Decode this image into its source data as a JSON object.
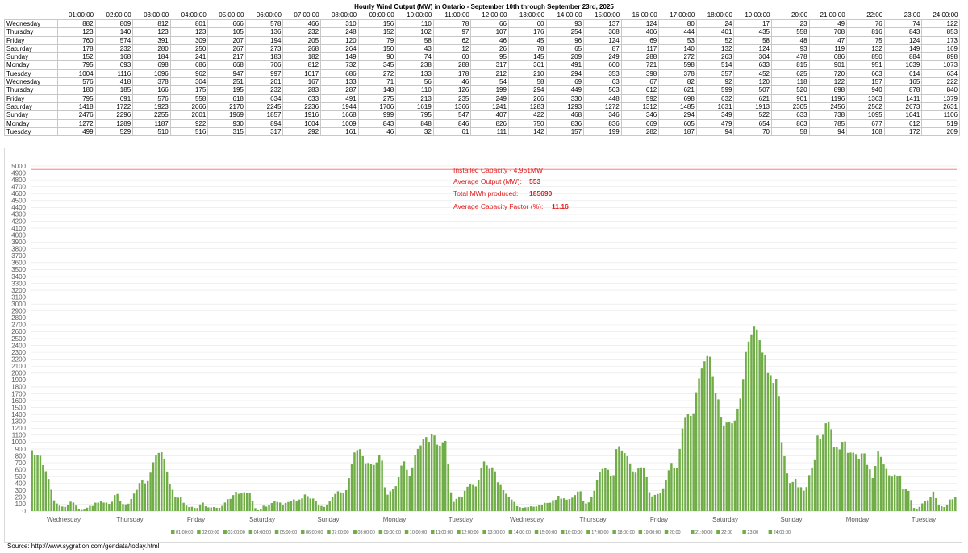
{
  "title": "Hourly Wind Output (MW) in Ontario - September 10th through September 23rd, 2025",
  "source": "Source: http://www.sygration.com/gendata/today.html",
  "hours": [
    "01:00:00",
    "02:00:00",
    "03:00:00",
    "04:00:00",
    "05:00:00",
    "06:00:00",
    "07:00:00",
    "08:00:00",
    "09:00:00",
    "10:00:00",
    "11:00:00",
    "12:00:00",
    "13:00:00",
    "14:00:00",
    "15:00:00",
    "16:00:00",
    "17:00:00",
    "18:00:00",
    "19:00:00",
    "20:00",
    "21:00:00",
    "22:00",
    "23:00",
    "24:00:00"
  ],
  "annotations": {
    "capacity_label": "Installed Capacity - 4,951MW",
    "avg_output_label": "Average Output (MW):",
    "avg_output_value": "553",
    "total_label": "Total MWh produced:",
    "total_value": "185690",
    "cf_label": "Average Capacity Factor (%):",
    "cf_value": "11.16"
  },
  "chart_data": {
    "type": "bar",
    "title": "Hourly Wind Output (MW) in Ontario - September 10th through September 23rd, 2025",
    "ylim": [
      0,
      5000
    ],
    "ytick_step": 100,
    "grid": true,
    "legend": "bottom",
    "series_color": "#70ad47",
    "capacity_line": 4951,
    "capacity_color": "#ff6b6b",
    "days": [
      {
        "day": "Wednesday",
        "values": [
          882,
          809,
          812,
          801,
          666,
          578,
          466,
          310,
          156,
          110,
          78,
          66,
          60,
          93,
          137,
          124,
          80,
          24,
          17,
          23,
          49,
          76,
          74,
          122
        ]
      },
      {
        "day": "Thursday",
        "values": [
          123,
          140,
          123,
          123,
          105,
          136,
          232,
          248,
          152,
          102,
          97,
          107,
          176,
          254,
          308,
          406,
          444,
          401,
          435,
          558,
          708,
          816,
          843,
          853
        ]
      },
      {
        "day": "Friday",
        "values": [
          760,
          574,
          391,
          309,
          207,
          194,
          205,
          120,
          79,
          58,
          62,
          46,
          45,
          96,
          124,
          69,
          53,
          52,
          58,
          48,
          47,
          75,
          124,
          173
        ]
      },
      {
        "day": "Saturday",
        "values": [
          178,
          232,
          280,
          250,
          267,
          273,
          268,
          264,
          150,
          43,
          12,
          26,
          78,
          65,
          87,
          117,
          140,
          132,
          124,
          93,
          119,
          132,
          149,
          169
        ]
      },
      {
        "day": "Sunday",
        "values": [
          152,
          168,
          184,
          241,
          217,
          183,
          182,
          149,
          90,
          74,
          60,
          95,
          145,
          209,
          249,
          288,
          272,
          263,
          304,
          478,
          686,
          850,
          884,
          898
        ]
      },
      {
        "day": "Monday",
        "values": [
          795,
          693,
          698,
          686,
          668,
          706,
          812,
          732,
          345,
          238,
          288,
          317,
          361,
          491,
          660,
          721,
          598,
          514,
          633,
          815,
          901,
          951,
          1039,
          1073
        ]
      },
      {
        "day": "Tuesday",
        "values": [
          1004,
          1116,
          1096,
          962,
          947,
          997,
          1017,
          686,
          272,
          133,
          178,
          212,
          210,
          294,
          353,
          398,
          378,
          357,
          452,
          625,
          720,
          663,
          614,
          634
        ]
      },
      {
        "day": "Wednesday",
        "values": [
          576,
          418,
          378,
          304,
          251,
          201,
          167,
          133,
          71,
          56,
          46,
          54,
          58,
          69,
          63,
          67,
          82,
          92,
          120,
          118,
          122,
          157,
          165,
          222
        ]
      },
      {
        "day": "Thursday",
        "values": [
          180,
          185,
          166,
          175,
          195,
          232,
          283,
          287,
          148,
          110,
          126,
          199,
          294,
          449,
          563,
          612,
          621,
          599,
          507,
          520,
          898,
          940,
          878,
          840
        ]
      },
      {
        "day": "Friday",
        "values": [
          795,
          691,
          576,
          558,
          618,
          634,
          633,
          491,
          275,
          213,
          235,
          249,
          266,
          330,
          448,
          592,
          698,
          632,
          621,
          901,
          1196,
          1363,
          1411,
          1379
        ]
      },
      {
        "day": "Saturday",
        "values": [
          1418,
          1722,
          1923,
          2066,
          2170,
          2245,
          2236,
          1944,
          1706,
          1619,
          1366,
          1241,
          1283,
          1293,
          1272,
          1312,
          1485,
          1631,
          1913,
          2305,
          2456,
          2562,
          2673,
          2631
        ]
      },
      {
        "day": "Sunday",
        "values": [
          2476,
          2296,
          2255,
          2001,
          1969,
          1857,
          1916,
          1668,
          999,
          795,
          547,
          407,
          422,
          468,
          346,
          346,
          294,
          349,
          522,
          633,
          738,
          1095,
          1041,
          1106
        ]
      },
      {
        "day": "Monday",
        "values": [
          1272,
          1289,
          1187,
          922,
          930,
          894,
          1004,
          1009,
          843,
          848,
          846,
          826,
          750,
          836,
          836,
          669,
          605,
          479,
          654,
          863,
          785,
          677,
          612,
          519
        ]
      },
      {
        "day": "Tuesday",
        "values": [
          499,
          529,
          510,
          516,
          315,
          317,
          292,
          161,
          46,
          32,
          61,
          111,
          142,
          157,
          199,
          282,
          187,
          94,
          70,
          58,
          94,
          168,
          172,
          209
        ]
      }
    ]
  }
}
